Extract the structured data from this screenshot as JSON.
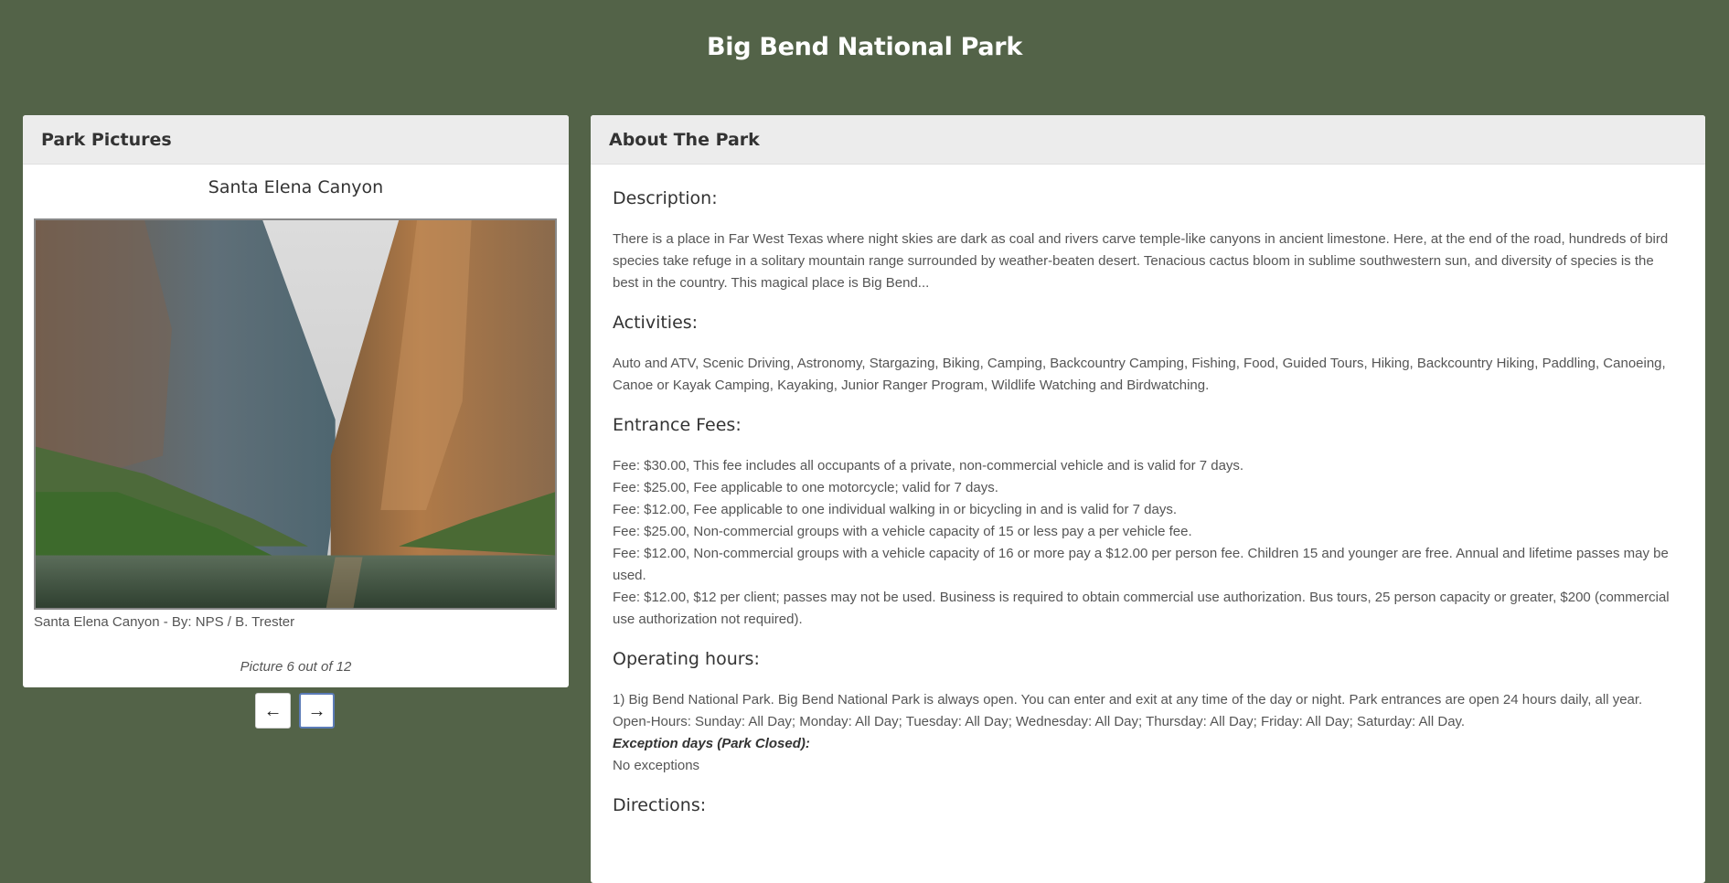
{
  "page": {
    "title": "Big Bend National Park"
  },
  "pictures": {
    "header": "Park Pictures",
    "current_title": "Santa Elena Canyon",
    "caption": "Santa Elena Canyon - By: NPS / B. Trester",
    "counter": "Picture 6 out of 12",
    "prev_icon": "arrow-left-icon",
    "next_icon": "arrow-right-icon"
  },
  "about": {
    "header": "About The Park",
    "description_title": "Description:",
    "description": "There is a place in Far West Texas where night skies are dark as coal and rivers carve temple-like canyons in ancient limestone. Here, at the end of the road, hundreds of bird species take refuge in a solitary mountain range surrounded by weather-beaten desert. Tenacious cactus bloom in sublime southwestern sun, and diversity of species is the best in the country. This magical place is Big Bend...",
    "activities_title": "Activities:",
    "activities": "Auto and ATV, Scenic Driving, Astronomy, Stargazing, Biking, Camping, Backcountry Camping, Fishing, Food, Guided Tours, Hiking, Backcountry Hiking, Paddling, Canoeing, Canoe or Kayak Camping, Kayaking, Junior Ranger Program, Wildlife Watching and Birdwatching.",
    "fees_title": "Entrance Fees:",
    "fees": [
      "Fee: $30.00, This fee includes all occupants of a private, non-commercial vehicle and is valid for 7 days.",
      "Fee: $25.00, Fee applicable to one motorcycle; valid for 7 days.",
      "Fee: $12.00, Fee applicable to one individual walking in or bicycling in and is valid for 7 days.",
      "Fee: $25.00, Non-commercial groups with a vehicle capacity of 15 or less pay a per vehicle fee.",
      "Fee: $12.00, Non-commercial groups with a vehicle capacity of 16 or more pay a $12.00 per person fee. Children 15 and younger are free. Annual and lifetime passes may be used.",
      "Fee: $12.00, $12 per client; passes may not be used. Business is required to obtain commercial use authorization. Bus tours, 25 person capacity or greater, $200 (commercial use authorization not required)."
    ],
    "hours_title": "Operating hours:",
    "hours_description": "1) Big Bend National Park. Big Bend National Park is always open. You can enter and exit at any time of the day or night. Park entrances are open 24 hours daily, all year.",
    "open_hours": "Open-Hours: Sunday: All Day; Monday: All Day; Tuesday: All Day; Wednesday: All Day; Thursday: All Day; Friday: All Day; Saturday: All Day.",
    "exception_label": "Exception days (Park Closed):",
    "exceptions": "No exceptions",
    "directions_title": "Directions:"
  },
  "colors": {
    "background": "#536348",
    "header_bg": "#ececec",
    "next_button_border": "#5b7bb7"
  }
}
